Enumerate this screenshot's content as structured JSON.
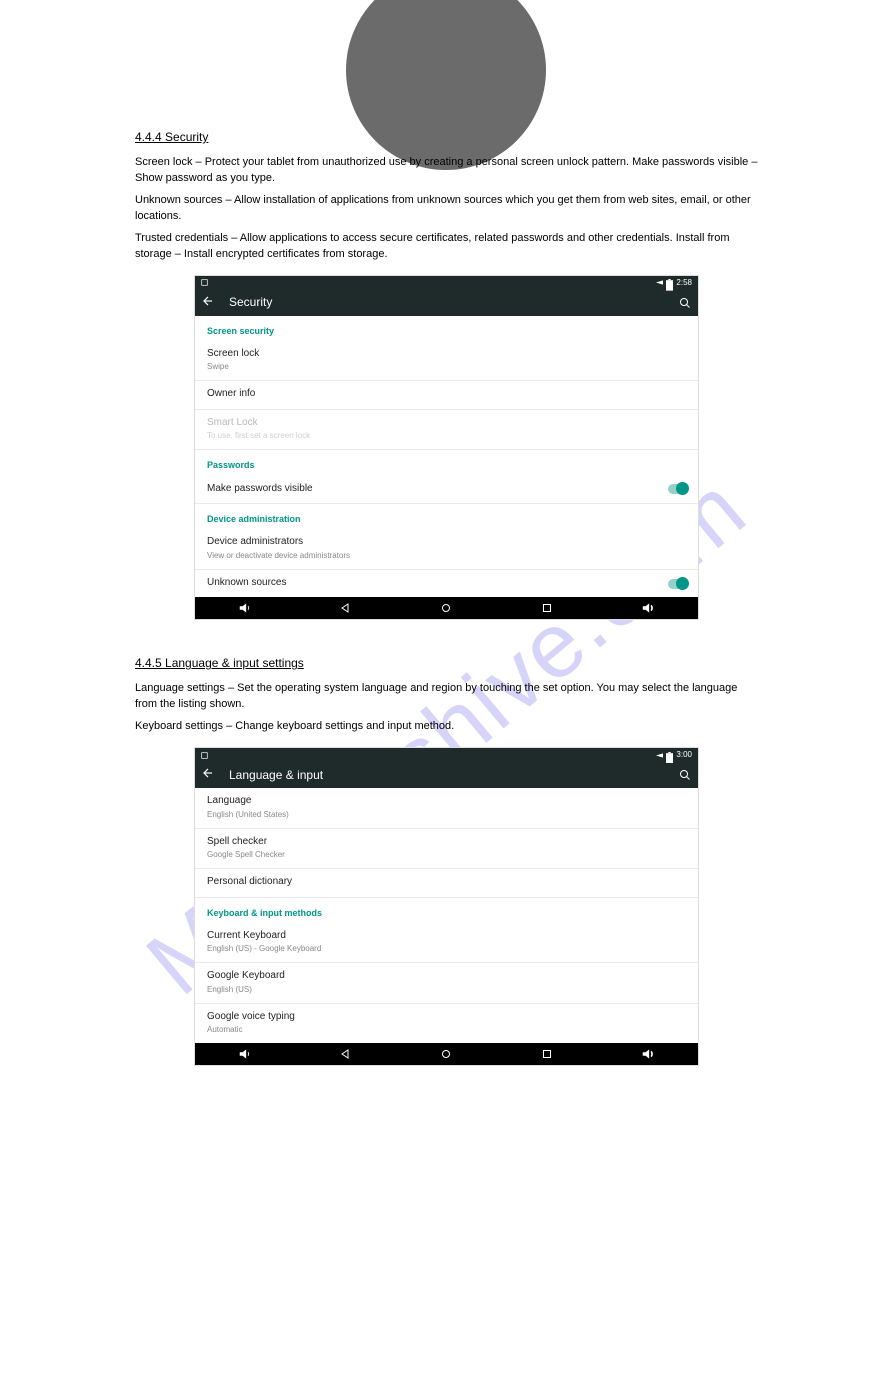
{
  "watermark": "Manualshive.com",
  "section1": {
    "title": "4.4.4 Security",
    "p1": "Screen lock – Protect your tablet from unauthorized use by creating a personal screen unlock pattern. Make passwords visible – Show password as you type.",
    "p2": "Unknown sources – Allow installation of applications from unknown sources which you get them from web sites, email, or other locations.",
    "p3": "Trusted credentials – Allow applications to access secure certificates, related passwords and other credentials. Install from storage – Install encrypted certificates from storage."
  },
  "security_screen": {
    "status_time": "2:58",
    "title": "Security",
    "cat_screen": "Screen security",
    "screen_lock": {
      "title": "Screen lock",
      "sub": "Swipe"
    },
    "owner_info": {
      "title": "Owner info"
    },
    "smart_lock": {
      "title": "Smart Lock",
      "sub": "To use, first set a screen lock"
    },
    "cat_passwords": "Passwords",
    "make_visible": {
      "title": "Make passwords visible"
    },
    "cat_admin": "Device administration",
    "device_admins": {
      "title": "Device administrators",
      "sub": "View or deactivate device administrators"
    },
    "unknown_sources": {
      "title": "Unknown sources"
    }
  },
  "section2": {
    "title": "4.4.5 Language & input settings",
    "p1": "Language settings – Set the operating system language and region by touching the set option. You may select the language from the listing shown.",
    "p2": "Keyboard settings – Change keyboard settings and input method."
  },
  "lang_screen": {
    "status_time": "3:00",
    "title": "Language & input",
    "language": {
      "title": "Language",
      "sub": "English (United States)"
    },
    "spell": {
      "title": "Spell checker",
      "sub": "Google Spell Checker"
    },
    "dict": {
      "title": "Personal dictionary"
    },
    "cat_keyboard": "Keyboard & input methods",
    "current_kb": {
      "title": "Current Keyboard",
      "sub": "English (US) - Google Keyboard"
    },
    "google_kb": {
      "title": "Google Keyboard",
      "sub": "English (US)"
    },
    "voice": {
      "title": "Google voice typing",
      "sub": "Automatic"
    }
  }
}
